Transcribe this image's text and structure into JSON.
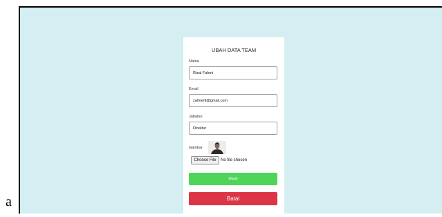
{
  "stray_text": "a",
  "form": {
    "title": "UBAH DATA TEAM",
    "nama_label": "Nama",
    "nama_value": "Rizal Fahmi",
    "email_label": "Email",
    "email_value": "zalmerfi@gmail.com",
    "jabatan_label": "Jabatan",
    "jabatan_value": "Direktur",
    "gambar_label": "Gambar",
    "file_button_label": "Choose File",
    "file_status": "No file chosen",
    "ubah_label": "Ubah",
    "batal_label": "Batal"
  },
  "colors": {
    "page_background": "#d4eef1",
    "ubah_button": "#4fd45a",
    "batal_button": "#dc3545"
  }
}
